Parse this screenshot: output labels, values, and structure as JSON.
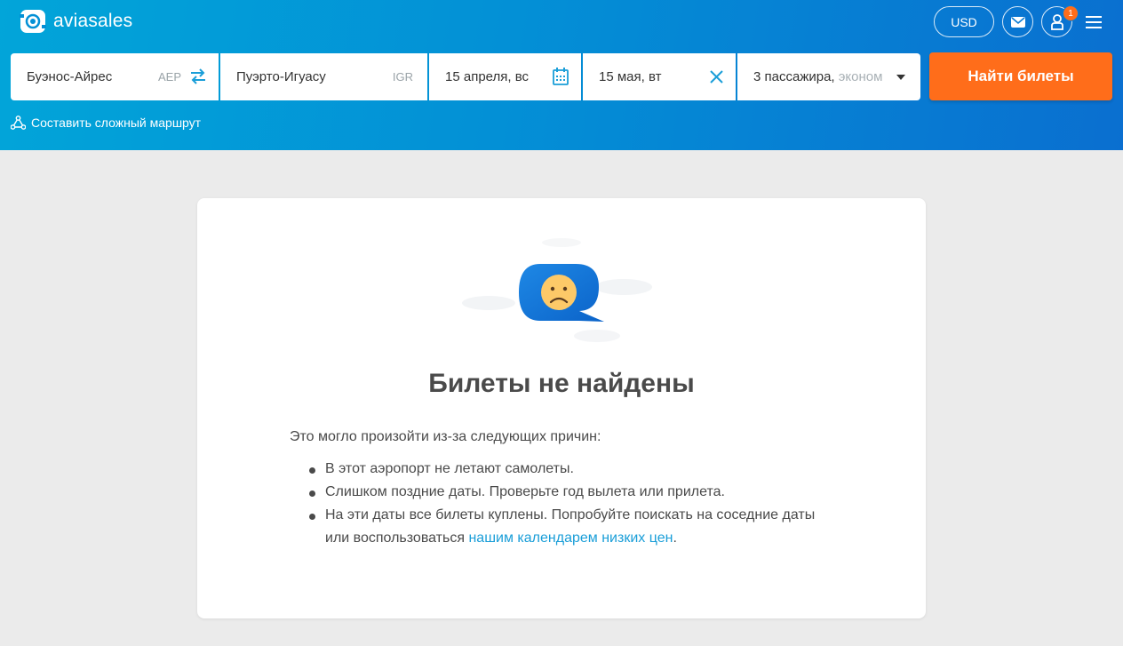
{
  "header": {
    "logo_text": "aviasales",
    "currency": "USD",
    "notification_count": "1"
  },
  "search": {
    "origin": "Буэнос-Айрес",
    "origin_code": "AEP",
    "destination": "Пуэрто-Игуасу",
    "destination_code": "IGR",
    "depart_date": "15 апреля, вс",
    "return_date": "15 мая, вт",
    "passengers": "3 пассажира,",
    "cabin_class": "эконом",
    "search_button": "Найти билеты",
    "complex_route": "Составить сложный маршрут"
  },
  "result": {
    "title": "Билеты не найдены",
    "intro": "Это могло произойти из-за следующих причин:",
    "reason_1": "В этот аэропорт не летают самолеты.",
    "reason_2": "Слишком поздние даты. Проверьте год вылета или прилета.",
    "reason_3_text": "На эти даты все билеты куплены. Попробуйте поискать на соседние даты или воспользоваться",
    "reason_3_link": "нашим календарем низких цен",
    "reason_3_end": "."
  },
  "colors": {
    "accent_orange": "#ff6d1a",
    "header_blue": "#0390d6",
    "link_blue": "#1a9ed8"
  }
}
